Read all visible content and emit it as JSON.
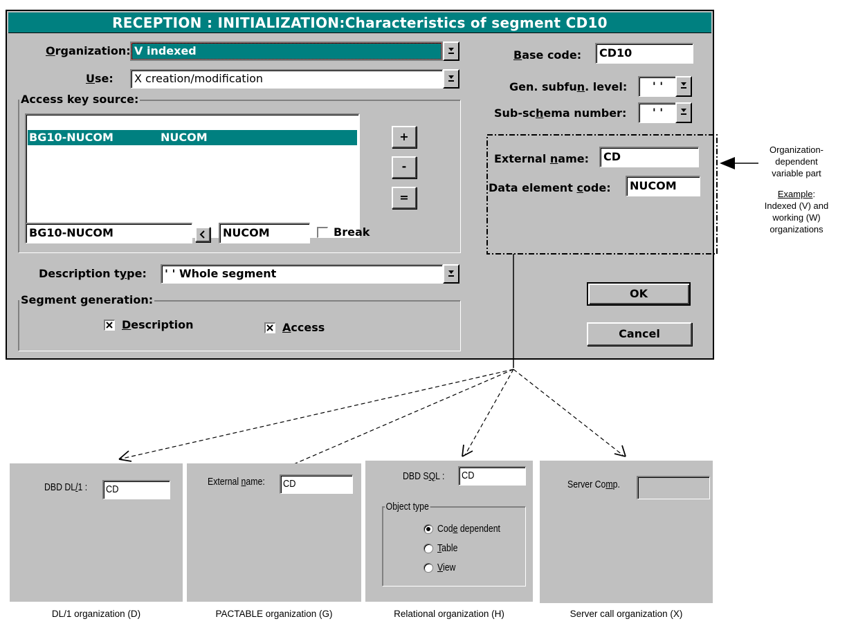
{
  "dialog": {
    "title": "RECEPTION : INITIALIZATION:Characteristics of segment CD10",
    "organization": {
      "label_u": "O",
      "label_rest": "rganization:",
      "value": "V indexed"
    },
    "use": {
      "label_u": "U",
      "label_rest": "se:",
      "value": "X creation/modification"
    },
    "base_code": {
      "label_u": "B",
      "label_rest": "ase code:",
      "value": "CD10"
    },
    "gen_subfun": {
      "label_pre": "Gen. subfu",
      "label_u": "n",
      "label_post": ". level:",
      "value": "' '"
    },
    "sub_schema": {
      "label_pre": "Sub-sc",
      "label_u": "h",
      "label_post": "ema number:",
      "value": "' '"
    },
    "access_key": {
      "group_label": "Access key source:",
      "rows": [
        {
          "col1": "BG10-NUCOM",
          "col2": "NUCOM",
          "selected": true
        }
      ],
      "input_left": "BG10-NUCOM",
      "input_right": "NUCOM",
      "move_button": "<",
      "break_label": "Break",
      "break_checked": false,
      "buttons": {
        "add": "+",
        "remove": "-",
        "equal": "="
      }
    },
    "variable_part": {
      "external_name": {
        "label_pre": "External ",
        "label_u": "n",
        "label_post": "ame:",
        "value": "CD"
      },
      "data_element": {
        "label_pre": "Data element ",
        "label_u": "c",
        "label_post": "ode:",
        "value": "NUCOM"
      }
    },
    "description_type": {
      "label_pre": "Description t",
      "label_u": "y",
      "label_post": "pe:",
      "value": "' ' Whole segment"
    },
    "segment_generation": {
      "group_label": "Segment generation:",
      "description": {
        "label_u": "D",
        "label_rest": "escription",
        "checked": true
      },
      "access": {
        "label_u": "A",
        "label_rest": "ccess",
        "checked": true
      }
    },
    "ok_label": "OK",
    "cancel_label": "Cancel"
  },
  "annotation": {
    "line1": "Organization-",
    "line2": "dependent",
    "line3": "variable part",
    "example_label": "Example",
    "example_colon": ":",
    "line4": "Indexed (V) and",
    "line5": "working (W)",
    "line6": "organizations"
  },
  "panels": {
    "dl1": {
      "label_pre": "DBD DL",
      "label_u": "/",
      "label_post": "1 :",
      "value": "CD",
      "caption": "DL/1 organization (D)"
    },
    "pactable": {
      "label_pre": "External ",
      "label_u": "n",
      "label_post": "ame:",
      "value": "CD",
      "caption": "PACTABLE organization (G)"
    },
    "relational": {
      "label_pre": "DBD S",
      "label_u": "Q",
      "label_post": "L :",
      "value": "CD",
      "object_type_label": "Object type",
      "options": [
        {
          "pre": "Cod",
          "u": "e",
          "post": " dependent",
          "selected": true
        },
        {
          "pre": "",
          "u": "T",
          "post": "able",
          "selected": false
        },
        {
          "pre": "",
          "u": "V",
          "post": "iew",
          "selected": false
        }
      ],
      "caption": "Relational organization  (H)"
    },
    "server": {
      "label_pre": "Server Co",
      "label_u": "m",
      "label_post": "p.",
      "value": "",
      "caption": "Server call organization (X)"
    }
  },
  "colors": {
    "title_bg": "#008080",
    "window_bg": "#c0c0c0",
    "selection": "#008080"
  }
}
